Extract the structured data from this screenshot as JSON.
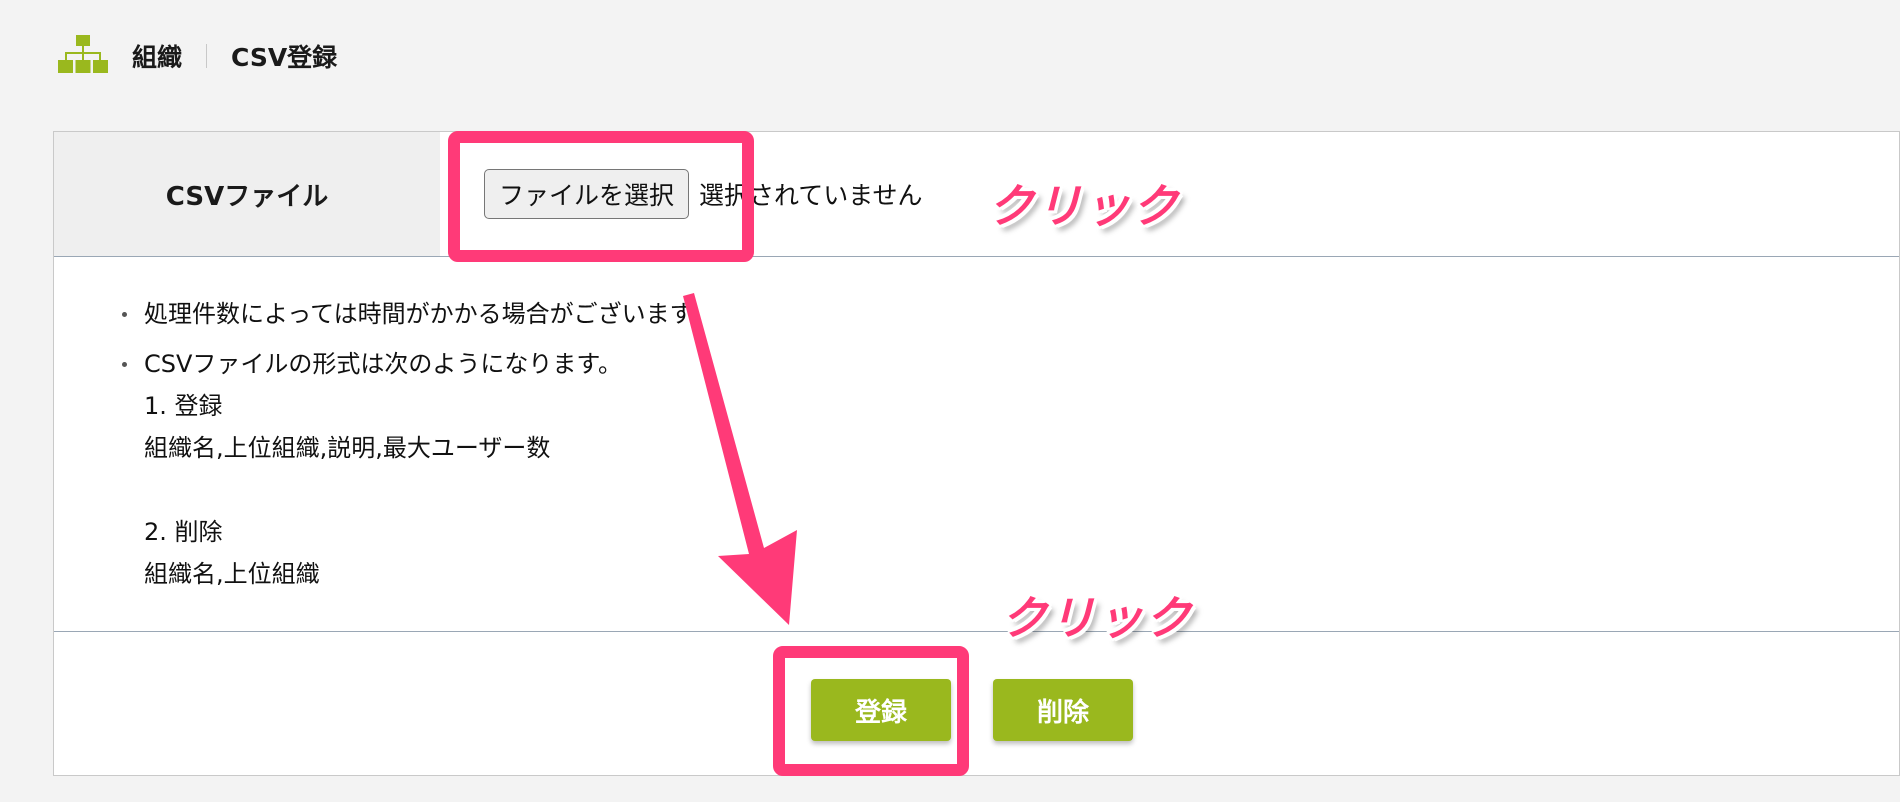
{
  "header": {
    "root_label": "組織",
    "current_label": "CSV登録",
    "icon": "org-chart-icon"
  },
  "form": {
    "file_label": "CSVファイル",
    "file_button_label": "ファイルを選択",
    "file_status": "選択されていません"
  },
  "notes": {
    "items": [
      "処理件数によっては時間がかかる場合がございます。",
      "CSVファイルの形式は次のようになります。"
    ],
    "format_lines": [
      "1. 登録",
      "組織名,上位組織,説明,最大ユーザー数",
      "",
      "2. 削除",
      "組織名,上位組織"
    ]
  },
  "actions": {
    "register_label": "登録",
    "delete_label": "削除"
  },
  "annotations": {
    "callout_text": "クリック",
    "callout_text_2": "クリック",
    "highlight_color": "#ff3a78"
  },
  "colors": {
    "accent": "#9ab81e",
    "background": "#f3f3f3"
  }
}
